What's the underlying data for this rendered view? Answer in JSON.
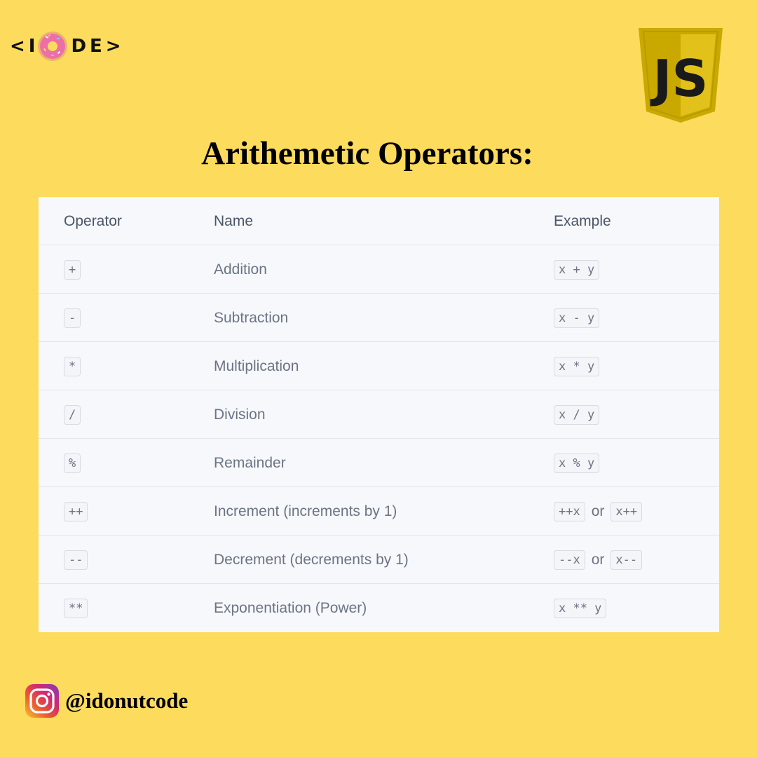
{
  "brand": {
    "logo_left": "<I",
    "logo_right": "DE>",
    "logo_icon": "donut-icon",
    "badge_icon": "javascript-shield-icon",
    "badge_text": "JS",
    "accent": "#FDDB5C"
  },
  "title": "Arithemetic Operators:",
  "table": {
    "headers": [
      "Operator",
      "Name",
      "Example"
    ],
    "rows": [
      {
        "operator": "+",
        "name": "Addition",
        "example": "x + y"
      },
      {
        "operator": "-",
        "name": "Subtraction",
        "example": "x - y"
      },
      {
        "operator": "*",
        "name": "Multiplication",
        "example": "x * y"
      },
      {
        "operator": "/",
        "name": "Division",
        "example": "x / y"
      },
      {
        "operator": "%",
        "name": "Remainder",
        "example": "x % y"
      },
      {
        "operator": "++",
        "name": "Increment (increments by 1)",
        "example": "++x",
        "or": "or",
        "example_alt": "x++"
      },
      {
        "operator": "--",
        "name": "Decrement (decrements by 1)",
        "example": "--x",
        "or": "or",
        "example_alt": "x--"
      },
      {
        "operator": "**",
        "name": "Exponentiation (Power)",
        "example": "x ** y"
      }
    ]
  },
  "footer": {
    "icon": "instagram-icon",
    "handle": "@idonutcode"
  }
}
